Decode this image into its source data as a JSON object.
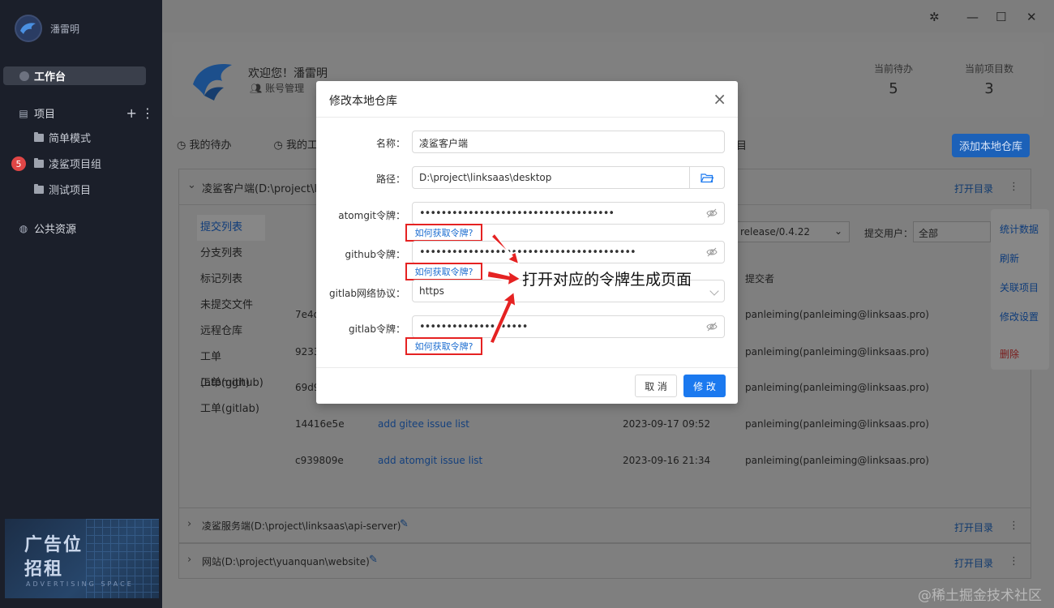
{
  "sidebar": {
    "user_name": "潘雷明",
    "workbench": "工作台",
    "projects": "项目",
    "project_items": [
      "简单模式",
      "凌鲨项目组",
      "测试项目"
    ],
    "badge": "5",
    "public": "公共资源"
  },
  "ad": {
    "line1": "广告位",
    "line2": "招租",
    "line3": "ADVERTISING SPACE"
  },
  "header": {
    "welcome": "欢迎您！潘雷明",
    "account": "账号管理",
    "stats": [
      {
        "label": "当前待办",
        "value": "5"
      },
      {
        "label": "当前项目数",
        "value": "3"
      }
    ]
  },
  "tabs": {
    "todo": "我的待办",
    "work": "我的工作",
    "project_tail": "目"
  },
  "add_repo": "添加本地仓库",
  "repo_panel": {
    "title": "凌鲨客户端(D:\\project\\links",
    "open_dir": "打开目录",
    "sub_tabs": [
      "提交列表",
      "分支列表",
      "标记列表",
      "未提交文件",
      "远程仓库",
      "工单(atomgit)",
      "工单(github)",
      "工单(gitlab)"
    ],
    "branch": "release/0.4.22",
    "user_filter_label": "提交用户：",
    "user_filter": "全部",
    "col_committer": "提交者",
    "rows": [
      {
        "hash": "7e4d",
        "msg": "",
        "date": "",
        "committer": "panleiming(panleiming@linksaas.pro)"
      },
      {
        "hash": "9233",
        "msg": "",
        "date": "",
        "committer": "panleiming(panleiming@linksaas.pro)"
      },
      {
        "hash": "69d9",
        "msg": "",
        "date": "",
        "committer": "panleiming(panleiming@linksaas.pro)"
      },
      {
        "hash": "14416e5e",
        "msg": "add gitee issue list",
        "date": "2023-09-17 09:52",
        "committer": "panleiming(panleiming@linksaas.pro)"
      },
      {
        "hash": "c939809e",
        "msg": "add atomgit issue list",
        "date": "2023-09-16 21:34",
        "committer": "panleiming(panleiming@linksaas.pro)"
      }
    ]
  },
  "side_menu": [
    "统计数据",
    "刷新",
    "关联项目",
    "修改设置",
    "删除"
  ],
  "other_repos": [
    {
      "title": "凌鲨服务端(D:\\project\\linksaas\\api-server)",
      "open_dir": "打开目录"
    },
    {
      "title": "网站(D:\\project\\yuanquan\\website)",
      "open_dir": "打开目录"
    }
  ],
  "modal": {
    "title": "修改本地仓库",
    "name_label": "名称：",
    "name_value": "凌鲨客户端",
    "path_label": "路径：",
    "path_value": "D:\\project\\linksaas\\desktop",
    "atomgit_label": "atomgit令牌：",
    "atomgit_value": "••••••••••••••••••••••••••••••••••••",
    "github_label": "github令牌：",
    "github_value": "••••••••••••••••••••••••••••••••••••••••",
    "gitlab_proto_label": "gitlab网络协议：",
    "gitlab_proto_value": "https",
    "gitlab_label": "gitlab令牌：",
    "gitlab_value": "••••••••••••••••••••",
    "howto": "如何获取令牌?",
    "cancel": "取 消",
    "ok": "修 改"
  },
  "annotation": "打开对应的令牌生成页面",
  "watermark": "@稀土掘金技术社区",
  "colors": {
    "primary": "#1b79ef",
    "highlight": "#e52222",
    "sidebar": "#1b1f2a"
  }
}
